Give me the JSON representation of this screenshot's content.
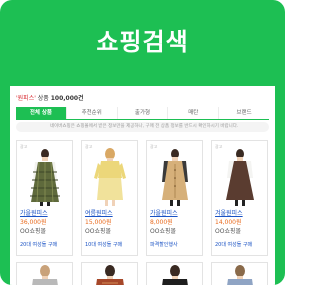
{
  "app": {
    "title": "쇼핑검색"
  },
  "results": {
    "keyword": "'원피스'",
    "label": " 상품 ",
    "count": "100,000건"
  },
  "tabs": [
    {
      "label": "전체 상품",
      "active": true
    },
    {
      "label": "추천순위",
      "active": false
    },
    {
      "label": "출가형",
      "active": false
    },
    {
      "label": "매탄",
      "active": false
    },
    {
      "label": "브랜드",
      "active": false
    }
  ],
  "notice": "네이버쇼핑은 쇼핑몰에서 받은 정보만을 제공하나, 구매 전 상품 정보를 반드시 확인하시기 바랍니다.",
  "products": [
    {
      "tag": "광고",
      "store": "가을원피스",
      "price": "36,000원",
      "source": "OO쇼핑몰",
      "hint": "20대 여성들 구매"
    },
    {
      "tag": "광고",
      "store": "여름원피스",
      "price": "15,000원",
      "source": "OO쇼핑몰",
      "hint": "10대 여성들 구매"
    },
    {
      "tag": "광고",
      "store": "가을원피스",
      "price": "8,000원",
      "source": "OO쇼핑몰",
      "hint": "파격할인행사"
    },
    {
      "tag": "광고",
      "store": "겨울원피스",
      "price": "14,000원",
      "source": "OO쇼핑몰",
      "hint": "20대 여성들 구매"
    }
  ],
  "colors": {
    "accent": "#1dbf53",
    "keyword": "#d8282f",
    "price": "#e86a1d",
    "link": "#1a52c4"
  },
  "product_images": [
    "plaid-dress-icon",
    "yellow-dress-icon",
    "beige-vest-dress-icon",
    "brown-dress-icon"
  ],
  "row2_images": [
    "grey-top-icon",
    "brown-sweater-icon",
    "black-top-icon",
    "blue-top-icon"
  ]
}
